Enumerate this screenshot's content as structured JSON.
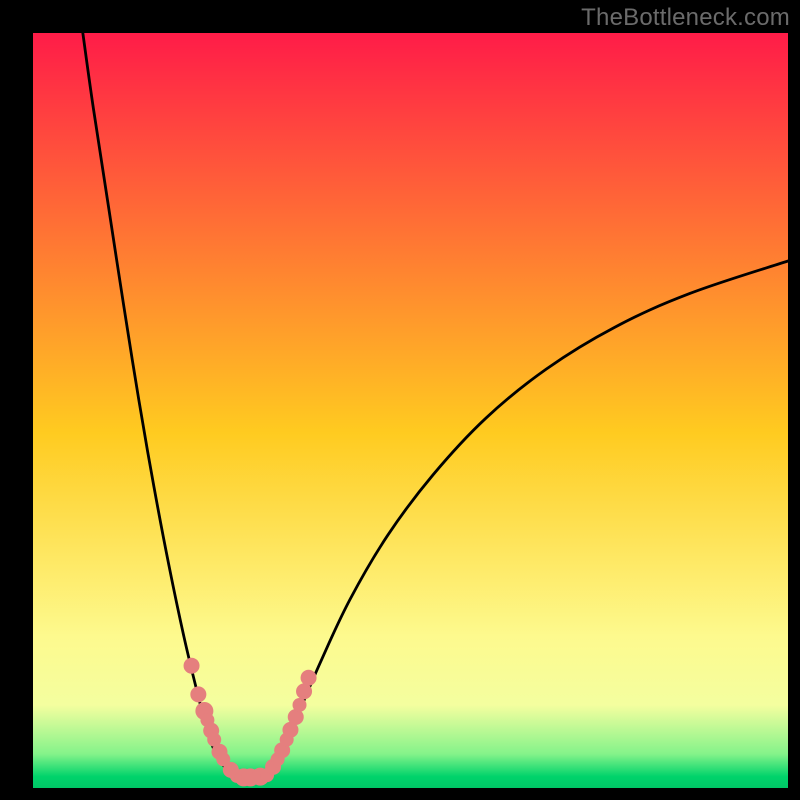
{
  "watermark": "TheBottleneck.com",
  "chart_data": {
    "type": "line",
    "title": "",
    "xlabel": "",
    "ylabel": "",
    "xlim": [
      0,
      100
    ],
    "ylim": [
      0,
      100
    ],
    "grid": false,
    "legend": false,
    "axes_visible": false,
    "background": {
      "type": "vertical-gradient",
      "stops": [
        {
          "pos": 0.0,
          "color": "#ff1c48"
        },
        {
          "pos": 0.53,
          "color": "#ffcb20"
        },
        {
          "pos": 0.8,
          "color": "#fdfa8e"
        },
        {
          "pos": 0.89,
          "color": "#f4fe9f"
        },
        {
          "pos": 0.955,
          "color": "#84f38a"
        },
        {
          "pos": 0.985,
          "color": "#00d36b"
        },
        {
          "pos": 1.0,
          "color": "#00c666"
        }
      ]
    },
    "series": [
      {
        "name": "left-arm",
        "stroke": "#000000",
        "note": "x values are approximate positions across plot width (0-100); y values are approximate heights (0 bottom, 100 top) read from the figure",
        "x": [
          6.6,
          8.0,
          10.0,
          12.0,
          14.0,
          16.0,
          18.0,
          20.0,
          21.8,
          23.0,
          24.0,
          25.2,
          26.2,
          27.0
        ],
        "y": [
          100.0,
          90.0,
          77.0,
          64.0,
          51.5,
          40.0,
          29.5,
          20.0,
          12.5,
          8.0,
          5.0,
          3.0,
          2.0,
          1.5
        ]
      },
      {
        "name": "valley-floor",
        "stroke": "#000000",
        "x": [
          27.0,
          28.0,
          29.0,
          30.0,
          31.0
        ],
        "y": [
          1.5,
          1.2,
          1.2,
          1.3,
          1.8
        ]
      },
      {
        "name": "right-arm",
        "stroke": "#000000",
        "x": [
          31.0,
          33.0,
          35.0,
          38.0,
          42.0,
          47.0,
          53.0,
          60.0,
          68.0,
          77.0,
          87.0,
          100.0
        ],
        "y": [
          1.8,
          5.0,
          9.5,
          16.5,
          25.0,
          33.5,
          41.5,
          49.0,
          55.5,
          61.0,
          65.5,
          69.8
        ]
      }
    ],
    "markers": {
      "name": "highlight-dots",
      "color": "#e57f7e",
      "radii_px": "mixed 6-9",
      "x": [
        21.0,
        21.9,
        22.7,
        23.1,
        23.6,
        24.0,
        24.7,
        25.2,
        26.2,
        27.0,
        27.9,
        28.8,
        30.1,
        31.0,
        31.8,
        32.4,
        33.0,
        33.6,
        34.1,
        34.8,
        35.3,
        35.9,
        36.5
      ],
      "y": [
        16.2,
        12.4,
        10.2,
        9.0,
        7.6,
        6.4,
        4.8,
        3.8,
        2.4,
        1.6,
        1.4,
        1.4,
        1.5,
        1.7,
        2.8,
        3.8,
        5.0,
        6.4,
        7.7,
        9.4,
        11.0,
        12.8,
        14.6
      ]
    }
  },
  "colors": {
    "frame": "#000000",
    "curve": "#000000",
    "dot": "#e57f7e"
  }
}
